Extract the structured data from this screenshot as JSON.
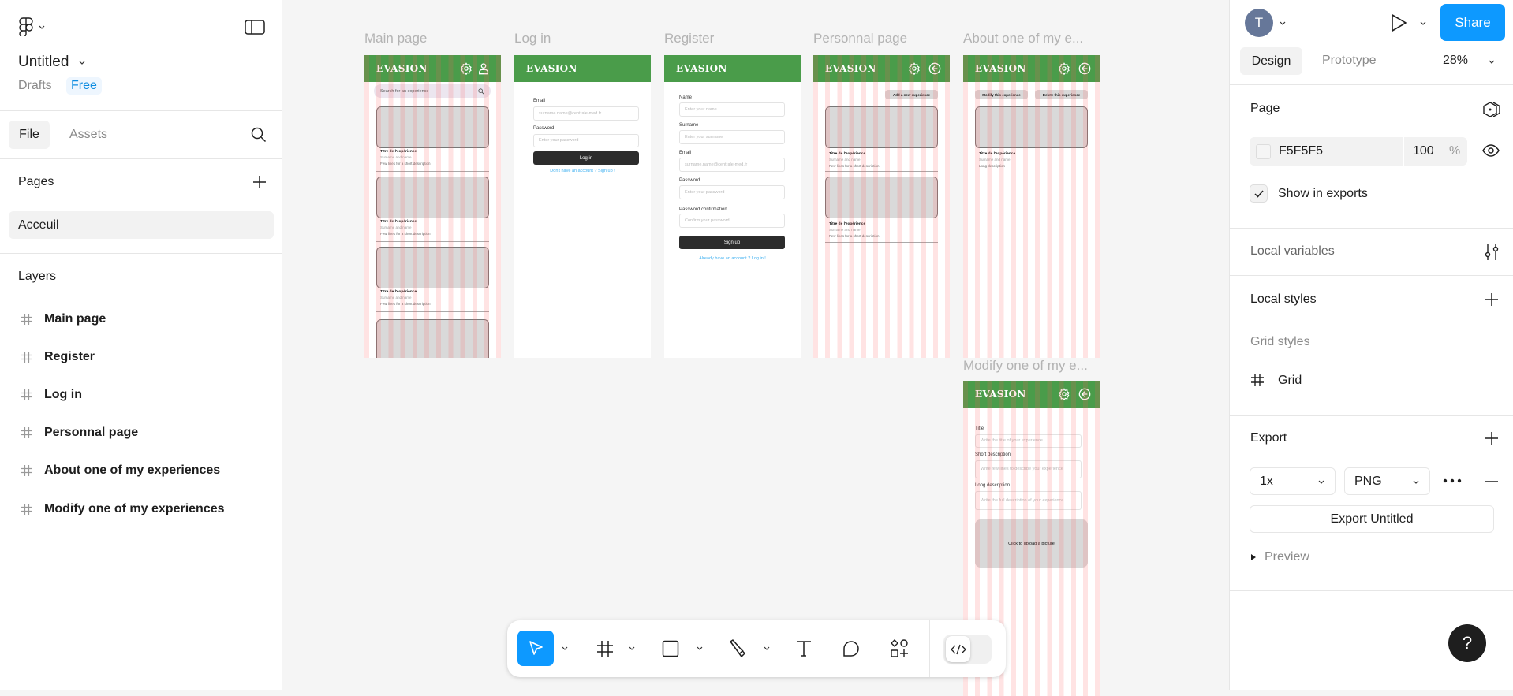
{
  "left_panel": {
    "file_title": "Untitled",
    "location": "Drafts",
    "plan_badge": "Free",
    "tabs": [
      "File",
      "Assets"
    ],
    "pages_heading": "Pages",
    "pages": [
      "Acceuil"
    ],
    "layers_heading": "Layers",
    "layers": [
      "Main page",
      "Register",
      "Log in",
      "Personnal page",
      "About one of my experiences",
      "Modify one of my experiences"
    ]
  },
  "right_panel": {
    "avatar_initial": "T",
    "share_label": "Share",
    "tabs": [
      "Design",
      "Prototype"
    ],
    "zoom": "28%",
    "page_heading": "Page",
    "page_color": "F5F5F5",
    "page_opacity": "100",
    "percent_sign": "%",
    "show_in_exports": "Show in exports",
    "show_in_exports_checked": true,
    "local_variables": "Local variables",
    "local_styles": "Local styles",
    "grid_styles": "Grid styles",
    "grid_style_name": "Grid",
    "export_heading": "Export",
    "export_scale": "1x",
    "export_format": "PNG",
    "export_button": "Export Untitled",
    "preview": "Preview",
    "help": "?"
  },
  "colors": {
    "accent": "#0d99ff",
    "canvas": "#F5F5F5",
    "app_header": "#4a9c4a",
    "dark_button": "#2c2c2c",
    "link": "#3fb0f0",
    "layout_grid": "#ff5a5a"
  },
  "toolbar": {
    "tools": [
      "move-icon",
      "frame-icon",
      "rectangle-icon",
      "pen-icon",
      "text-icon",
      "comment-icon",
      "actions-icon",
      "dev-mode-icon"
    ],
    "active_tool": "move"
  },
  "canvas": {
    "frames": {
      "main": {
        "label": "Main page",
        "brand": "EVASION",
        "search_placeholder": "Search for an experience",
        "card_title": "Titre de l'expérience",
        "card_author": "Surname and name",
        "card_desc": "Few lines for a short description"
      },
      "login": {
        "label": "Log in",
        "brand": "EVASION",
        "email_label": "Email",
        "email_placeholder": "surname.name@centrale-med.fr",
        "password_label": "Password",
        "password_placeholder": "Enter your password",
        "button": "Log in",
        "link": "Don't have an account ? Sign up !"
      },
      "register": {
        "label": "Register",
        "brand": "EVASION",
        "name_label": "Name",
        "name_placeholder": "Enter your name",
        "surname_label": "Surname",
        "surname_placeholder": "Enter your surname",
        "email_label": "Email",
        "email_placeholder": "surname.name@centrale-med.fr",
        "password_label": "Password",
        "password_placeholder": "Enter your password",
        "confirm_label": "Password confirmation",
        "confirm_placeholder": "Confirm your password",
        "button": "Sign up",
        "link": "Already have an account ? Log in !"
      },
      "personal": {
        "label": "Personnal page",
        "brand": "EVASION",
        "add_button": "Add a new experience",
        "card_title": "Titre de l'expérience",
        "card_author": "Surname and name",
        "card_desc": "Few lines for a short description"
      },
      "about": {
        "label": "About one of my e...",
        "brand": "EVASION",
        "modify_button": "Modify this experience",
        "delete_button": "Delete this experience",
        "card_title": "Titre de l'expérience",
        "card_author": "Surname and name",
        "card_desc": "Long description"
      },
      "modify": {
        "label": "Modify one of my e...",
        "brand": "EVASION",
        "title_label": "Title",
        "title_placeholder": "Write the title of your experience",
        "short_label": "Short description",
        "short_placeholder": "Write few lines to describe your experience",
        "long_label": "Long description",
        "long_placeholder": "Write the full description of your experience",
        "upload": "Click to upload a picture"
      }
    }
  }
}
